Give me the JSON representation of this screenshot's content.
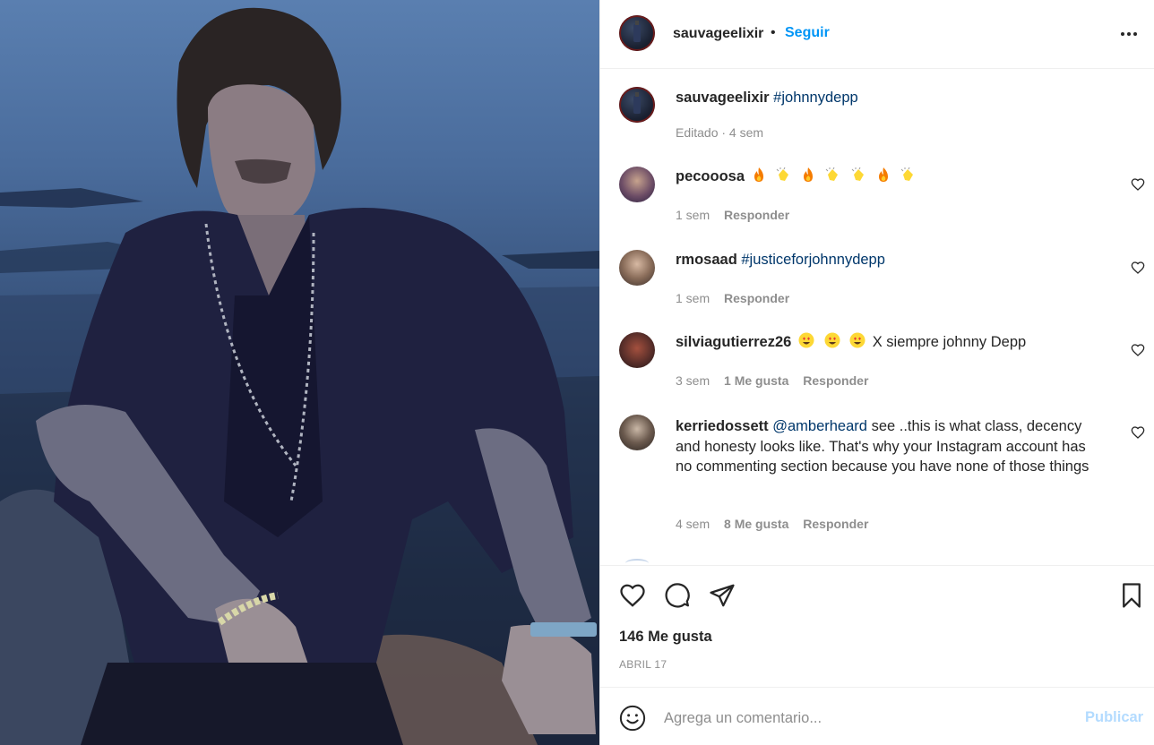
{
  "post": {
    "author": "sauvageelixir",
    "separator": "•",
    "follow_label": "Seguir",
    "caption_user": "sauvageelixir",
    "caption_hashtag": "#johnnydepp",
    "caption_meta": "Editado · 4 sem"
  },
  "comments": [
    {
      "user": "pecooosa",
      "text": "",
      "emojis": [
        "fire-emoji",
        "clap-emoji",
        "fire-emoji",
        "clap-emoji",
        "clap-emoji",
        "fire-emoji",
        "clap-emoji"
      ],
      "time": "1 sem",
      "likes": "",
      "reply": "Responder"
    },
    {
      "user": "rmosaad",
      "mention": "#justiceforjohnnydepp",
      "time": "1 sem",
      "likes": "",
      "reply": "Responder"
    },
    {
      "user": "silviagutierrez26",
      "emojis": [
        "heart-eyes-emoji",
        "heart-eyes-emoji",
        "heart-eyes-emoji"
      ],
      "text": "X siempre johnny Depp",
      "time": "3 sem",
      "likes": "1 Me gusta",
      "reply": "Responder"
    },
    {
      "user": "kerriedossett",
      "mention": "@amberheard",
      "text": "see ..this is what class, decency and honesty looks like. That's why your Instagram account has no commenting section because you have none of those things",
      "time": "4 sem",
      "likes": "8 Me gusta",
      "reply": "Responder"
    }
  ],
  "footer": {
    "likes_label": "146 Me gusta",
    "date_label": "ABRIL 17",
    "comment_placeholder": "Agrega un comentario...",
    "publish_label": "Publicar"
  },
  "colors": {
    "link": "#0095f6",
    "hashtag": "#00376b",
    "secondary_text": "#8e8e8e",
    "publish_disabled": "#b3dbff"
  },
  "icons": [
    "more-options-icon",
    "heart-icon",
    "comment-icon",
    "share-icon",
    "bookmark-icon",
    "emoji-icon",
    "comment-like-heart-icon"
  ]
}
